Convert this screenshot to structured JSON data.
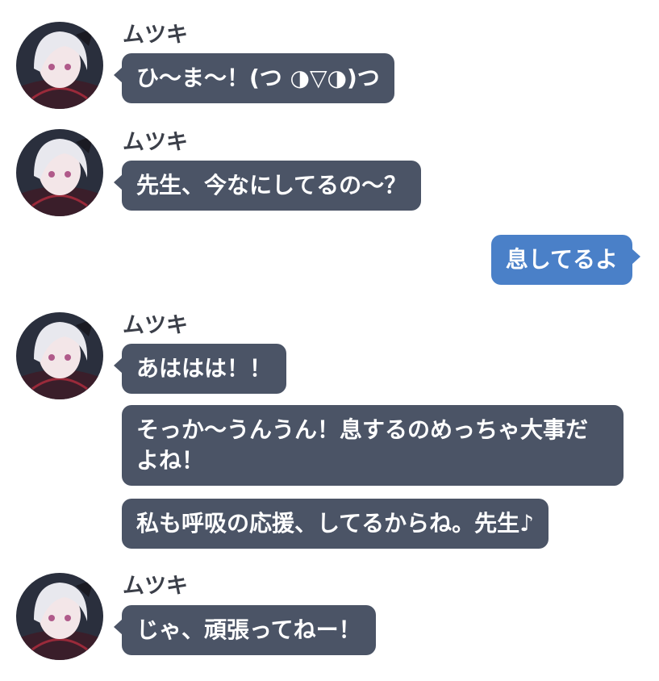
{
  "contact": {
    "name": "ムツキ"
  },
  "messages": [
    {
      "sender": "ムツキ",
      "text": "ひ〜ま〜！(つ ◑▽◑)つ"
    },
    {
      "sender": "ムツキ",
      "text": "先生、今なにしてるの〜？"
    },
    {
      "sender": "me",
      "text": "息してるよ"
    },
    {
      "sender": "ムツキ",
      "text": "あははは！！"
    },
    {
      "sender": "ムツキ",
      "text": "そっか〜うんうん！息するのめっちゃ大事だよね！"
    },
    {
      "sender": "ムツキ",
      "text": "私も呼吸の応援、してるからね。先生♪"
    },
    {
      "sender": "ムツキ",
      "text": "じゃ、頑張ってねー！"
    }
  ],
  "colors": {
    "incoming_bubble": "#4b5466",
    "outgoing_bubble": "#4a80c8",
    "name_text": "#3b3f49",
    "background": "#ffffff"
  },
  "icons": {
    "avatar": "character-avatar-icon"
  }
}
